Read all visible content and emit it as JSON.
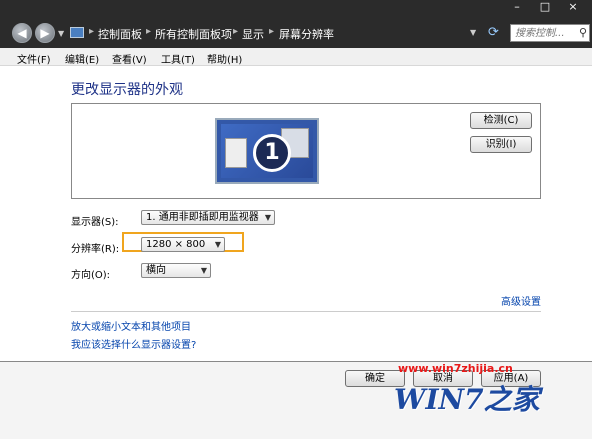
{
  "window": {
    "minimize_glyph": "–",
    "maximize_glyph": "□",
    "close_glyph": "×"
  },
  "nav": {
    "back_glyph": "◀",
    "forward_glyph": "▶",
    "breadcrumbs": [
      "控制面板",
      "所有控制面板项",
      "显示",
      "屏幕分辨率"
    ],
    "search_placeholder": "搜索控制...",
    "icons": {
      "back": "back-arrow-icon",
      "forward": "forward-arrow-icon",
      "refresh": "refresh-icon",
      "search": "search-icon",
      "location": "control-panel-icon"
    }
  },
  "menu": [
    "文件(F)",
    "编辑(E)",
    "查看(V)",
    "工具(T)",
    "帮助(H)"
  ],
  "main": {
    "title": "更改显示器的外观",
    "monitor_number": "1",
    "detect_label": "检测(C)",
    "identify_label": "识别(I)",
    "display_label": "显示器(S):",
    "display_value": "1. 通用非即插即用监视器",
    "resolution_label": "分辨率(R):",
    "resolution_value": "1280 × 800",
    "orientation_label": "方向(O):",
    "orientation_value": "横向",
    "advanced_link": "高级设置",
    "text_size_link": "放大或缩小文本和其他项目",
    "help_link": "我应该选择什么显示器设置?"
  },
  "footer": {
    "ok_label": "确定",
    "cancel_label": "取消",
    "apply_label": "应用(A)"
  },
  "watermark": {
    "url": "www.win7zhijia.cn",
    "logo": "WIN7之家"
  },
  "colors": {
    "titlebar": "#2b2b2b",
    "title_text": "#1e3287",
    "link": "#0645ad",
    "highlight": "#f0a51e",
    "watermark_url": "#e81818",
    "watermark_logo": "#1d4aa0"
  }
}
